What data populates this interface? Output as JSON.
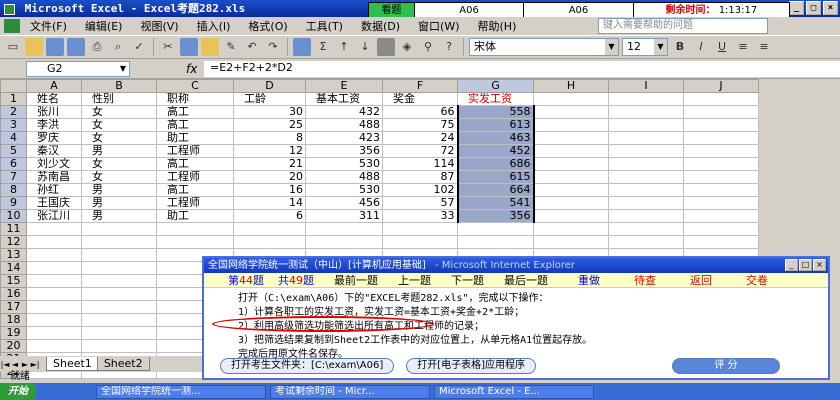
{
  "window": {
    "title": "Microsoft Excel - Excel考题282.xls",
    "buttons": [
      "_",
      "□",
      "×"
    ]
  },
  "timer": {
    "status": "看题",
    "code1": "A06",
    "code2": "A06",
    "remaining_label": "剩余时间：",
    "remaining_value": "1:13:17"
  },
  "menu": {
    "items": [
      "文件(F)",
      "编辑(E)",
      "视图(V)",
      "插入(I)",
      "格式(O)",
      "工具(T)",
      "数据(D)",
      "窗口(W)",
      "帮助(H)"
    ],
    "help_placeholder": "键入需要帮助的问题"
  },
  "toolbar": {
    "sum": "Σ",
    "font": "宋体",
    "size": "12",
    "bold": "B",
    "italic": "I",
    "underline": "U"
  },
  "formula": {
    "name_box": "G2",
    "fx": "fx",
    "content": "=E2+F2+2*D2"
  },
  "grid": {
    "columns": [
      "A",
      "B",
      "C",
      "D",
      "E",
      "F",
      "G",
      "H",
      "I",
      "J"
    ],
    "rows": [
      [
        "姓名",
        "性别",
        "职称",
        "工龄",
        "基本工资",
        "奖金",
        "实发工资",
        "",
        "",
        ""
      ],
      [
        "张川",
        "女",
        "高工",
        "30",
        "432",
        "66",
        "558",
        "",
        "",
        ""
      ],
      [
        "李洪",
        "女",
        "高工",
        "25",
        "488",
        "75",
        "613",
        "",
        "",
        ""
      ],
      [
        "罗庆",
        "女",
        "助工",
        "8",
        "423",
        "24",
        "463",
        "",
        "",
        ""
      ],
      [
        "秦汉",
        "男",
        "工程师",
        "12",
        "356",
        "72",
        "452",
        "",
        "",
        ""
      ],
      [
        "刘少文",
        "女",
        "高工",
        "21",
        "530",
        "114",
        "686",
        "",
        "",
        ""
      ],
      [
        "苏南昌",
        "女",
        "工程师",
        "20",
        "488",
        "87",
        "615",
        "",
        "",
        ""
      ],
      [
        "孙红",
        "男",
        "高工",
        "16",
        "530",
        "102",
        "664",
        "",
        "",
        ""
      ],
      [
        "王国庆",
        "男",
        "工程师",
        "14",
        "456",
        "57",
        "541",
        "",
        "",
        ""
      ],
      [
        "张江川",
        "男",
        "助工",
        "6",
        "311",
        "33",
        "356",
        "",
        "",
        ""
      ],
      [
        "",
        "",
        "",
        "",
        "",
        "",
        "",
        "",
        "",
        ""
      ],
      [
        "",
        "",
        "",
        "",
        "",
        "",
        "",
        "",
        "",
        ""
      ],
      [
        "",
        "",
        "",
        "",
        "",
        "",
        "",
        "",
        "",
        ""
      ],
      [
        "",
        "",
        "",
        "",
        "",
        "",
        "",
        "",
        "",
        ""
      ],
      [
        "",
        "",
        "",
        "",
        "",
        "",
        "",
        "",
        "",
        ""
      ],
      [
        "",
        "",
        "",
        "",
        "",
        "",
        "",
        "",
        "",
        ""
      ],
      [
        "",
        "",
        "",
        "",
        "",
        "",
        "",
        "",
        "",
        ""
      ],
      [
        "",
        "",
        "",
        "",
        "",
        "",
        "",
        "",
        "",
        ""
      ],
      [
        "",
        "",
        "",
        "",
        "",
        "",
        "",
        "",
        "",
        ""
      ],
      [
        "",
        "",
        "",
        "",
        "",
        "",
        "",
        "",
        "",
        ""
      ],
      [
        "",
        "",
        "",
        "",
        "",
        "",
        "",
        "",
        "",
        ""
      ],
      [
        "",
        "",
        "",
        "",
        "",
        "",
        "",
        "",
        "",
        ""
      ]
    ]
  },
  "sheets": {
    "nav": [
      "|◄",
      "◄",
      "►",
      "►|"
    ],
    "tabs": [
      "Sheet1",
      "Sheet2"
    ]
  },
  "status": "就绪",
  "taskbar": {
    "start": "开始",
    "tasks": [
      "全国网络学院统一测...",
      "考试剩余时间 - Micr...",
      "Microsoft Excel - E..."
    ]
  },
  "dialog": {
    "title": "全国网络学院统一测试（中山）[计算机应用基础]",
    "title_ghost": "- Microsoft Internet Explorer",
    "buttons": [
      "_",
      "□",
      "×"
    ],
    "nav": {
      "q_prefix": "第",
      "q_current": "44",
      "q_suffix": "题",
      "total_prefix": "共",
      "total": "49",
      "total_suffix": "题",
      "first": "最前一题",
      "prev": "上一题",
      "next": "下一题",
      "last": "最后一题",
      "redo": "重做",
      "pending": "待查",
      "back": "返回",
      "submit": "交卷"
    },
    "lines": [
      "打开（C:\\exam\\A06）下的\"EXCEL考题282.xls\"，完成以下操作：",
      "1）计算各职工的实发工资，实发工资=基本工资+奖金+2*工龄；",
      "2）利用高级筛选功能筛选出所有高工和工程师的记录；",
      "3）把筛选结果复制到Sheet2工作表中的对应位置上，从单元格A1位置起存放。",
      "完成后用原文件名保存。"
    ],
    "open_folder": "打开考生文件夹：[C:\\exam\\A06]",
    "open_app": "打开[电子表格]应用程序",
    "score": "评 分"
  }
}
